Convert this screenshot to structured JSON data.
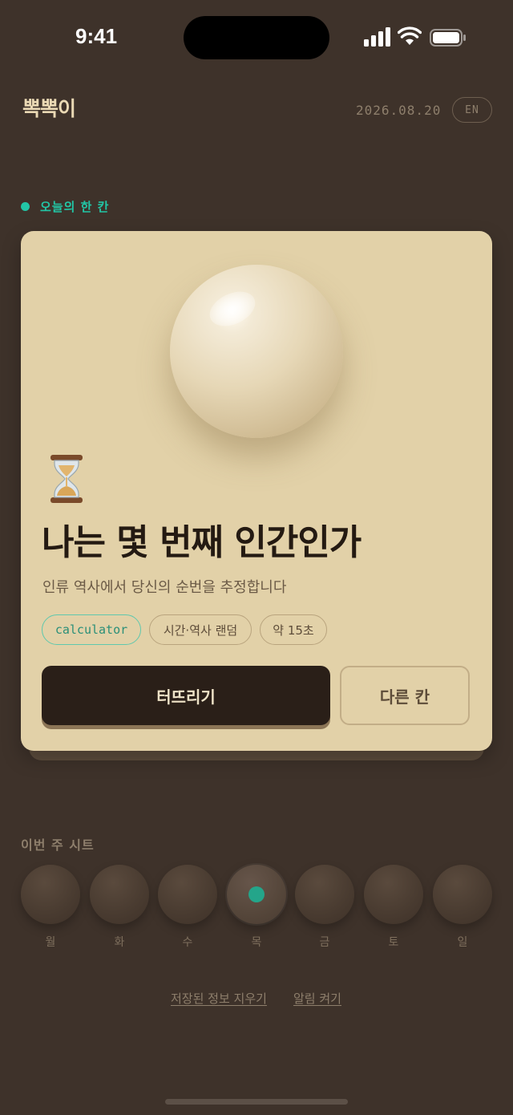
{
  "status": {
    "time": "9:41"
  },
  "header": {
    "logo": "뽁뽁이",
    "date": "2026.08.20",
    "lang": "EN"
  },
  "today": {
    "section_label": "오늘의 한 칸",
    "icon": "hourglass-icon",
    "title": "나는 몇 번째 인간인가",
    "description": "인류 역사에서 당신의 순번을 추정합니다",
    "tags": [
      "calculator",
      "시간·역사 랜덤",
      "약 15초"
    ],
    "primary_button": "터뜨리기",
    "secondary_button": "다른 칸"
  },
  "week": {
    "label": "이번 주 시트",
    "days": [
      "월",
      "화",
      "수",
      "목",
      "금",
      "토",
      "일"
    ],
    "today_index": 3
  },
  "footer": {
    "clear_link": "저장된 정보 지우기",
    "notify_link": "알림 켜기"
  },
  "colors": {
    "accent": "#22c6a6",
    "background": "#3e322a",
    "card": "#e2d1a8"
  }
}
